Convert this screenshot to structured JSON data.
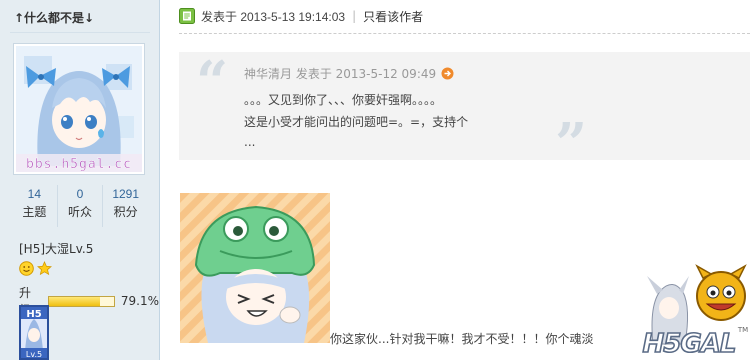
{
  "author": {
    "username": "↑什么都不是↓",
    "avatar_caption": "bbs.h5gal.cc",
    "stats": [
      {
        "value": "14",
        "label": "主题"
      },
      {
        "value": "0",
        "label": "听众"
      },
      {
        "value": "1291",
        "label": "积分"
      }
    ],
    "level_name": "[H5]大湿Lv.5",
    "upgrade_label": "升级",
    "upgrade_percent": "79.1%",
    "upgrade_fraction": 0.791,
    "medal": {
      "top_text": "H5",
      "bottom_text": "Lv.5"
    }
  },
  "post": {
    "posted_label": "发表于 2013-5-13 19:14:03",
    "separator": "|",
    "only_author_link": "只看该作者",
    "quote": {
      "author_line": "神华清月 发表于 2013-5-12 09:49",
      "lines": [
        "。。。又见到你了、、、你要奸强啊。。。。",
        "这是小受才能问出的问题吧=。=，支持个",
        "..."
      ]
    },
    "body_text": "你这家伙...针对我干嘛！我才不受！！！你个魂淡"
  },
  "watermark": {
    "text": "H5GAL",
    "tm": "TM"
  },
  "colors": {
    "sidebar_bg": "#e5edf2",
    "link_blue": "#336699",
    "quote_bg": "#f3f3f3",
    "quote_marks": "#d4dce3",
    "progress_fill": "#f0c010"
  }
}
